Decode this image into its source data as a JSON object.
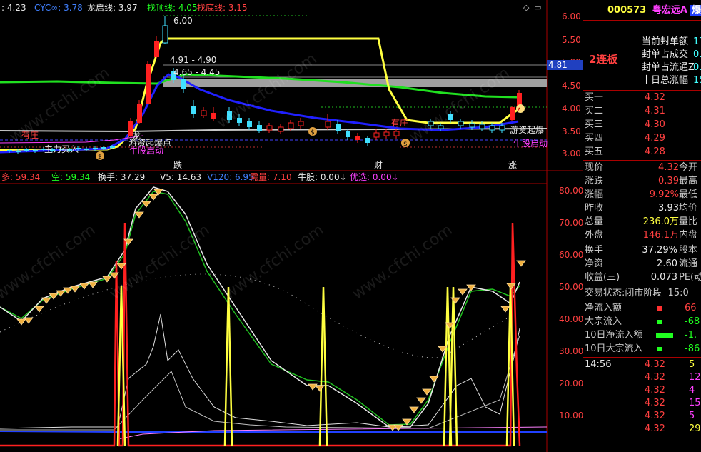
{
  "top_indicators": [
    {
      "text": ": 4.23",
      "color": "#e8e8e8"
    },
    {
      "text": "CYC∞: 3.78",
      "color": "#4080ff"
    },
    {
      "text": "龙启线: 3.97",
      "color": "#e8e8e8"
    },
    {
      "text": "找顶线: 4.05",
      "color": "#20ff20"
    },
    {
      "text": "找底线: 3.15",
      "color": "#ff4040"
    }
  ],
  "price_axis": [
    "6.00",
    "5.50",
    "5.00",
    "4.50",
    "4.00",
    "3.50",
    "3.00"
  ],
  "price_marker": "4.81",
  "chart_annotations": {
    "high": "6.00",
    "range1": "4.91 - 4.90",
    "range2": "4.65 - 4.45",
    "yz1": "有庄",
    "yz2": "有庄",
    "long1": "龙",
    "buy": "主力买入",
    "launch": "游资起爆点",
    "bull_start": "牛股启动",
    "bull_start2": "牛股启动",
    "explode": "游资起爆",
    "die": "跌",
    "cai": "财",
    "zhang": "涨"
  },
  "lower_indicators": [
    {
      "text": "多: 59.34",
      "color": "#ff4040"
    },
    {
      "text": "空: 59.34",
      "color": "#20ff20"
    },
    {
      "text": "换手: 37.29",
      "color": "#e8e8e8"
    },
    {
      "text": "V5: 14.63",
      "color": "#e8e8e8"
    },
    {
      "text": "V120: 6.95",
      "color": "#4080ff"
    },
    {
      "text": "需量: 7.10",
      "color": "#ff4040"
    },
    {
      "text": "牛股: 0.00↓",
      "color": "#e8e8e8"
    },
    {
      "text": "优选: 0.00↓",
      "color": "#ff40ff"
    }
  ],
  "lower_axis": [
    "80.00",
    "70.00",
    "60.00",
    "50.00",
    "40.00",
    "30.00",
    "20.00",
    "10.00"
  ],
  "stock": {
    "code": "000573",
    "name": "粤宏远A",
    "tag": "爆",
    "streak": "2连板",
    "seal_info": [
      {
        "label": "当前封单额",
        "value": "17"
      },
      {
        "label": "封单占成交",
        "value": "0."
      },
      {
        "label": "封单占流通Z",
        "value": "0."
      },
      {
        "label": "十日总涨幅",
        "value": "15."
      }
    ]
  },
  "order_book": [
    {
      "label": "买一",
      "price": "4.32"
    },
    {
      "label": "买二",
      "price": "4.31"
    },
    {
      "label": "买三",
      "price": "4.30"
    },
    {
      "label": "买四",
      "price": "4.29"
    },
    {
      "label": "买五",
      "price": "4.28"
    }
  ],
  "quote": [
    {
      "l1": "现价",
      "v1": "4.32",
      "c1": "red",
      "l2": "今开"
    },
    {
      "l1": "涨跌",
      "v1": "0.39",
      "c1": "red",
      "l2": "最高"
    },
    {
      "l1": "涨幅",
      "v1": "9.92%",
      "c1": "red",
      "l2": "最低"
    },
    {
      "l1": "昨收",
      "v1": "3.93",
      "c1": "wht",
      "l2": "均价"
    },
    {
      "l1": "总量",
      "v1": "236.0万",
      "c1": "yel",
      "l2": "量比"
    },
    {
      "l1": "外盘",
      "v1": "146.1万",
      "c1": "red",
      "l2": "内盘"
    }
  ],
  "quote2": [
    {
      "l1": "换手",
      "v1": "37.29%",
      "l2": "股本"
    },
    {
      "l1": "净资",
      "v1": "2.60",
      "l2": "流通"
    },
    {
      "l1": "收益(三)",
      "v1": "0.073",
      "l2": "PE(动)"
    }
  ],
  "trade_state": {
    "label": "交易状态:",
    "value": "闭市阶段",
    "time": "15:0"
  },
  "flows": [
    {
      "label": "净流入额",
      "bar": "red",
      "value": "66",
      "vcolor": "red"
    },
    {
      "label": "大宗流入",
      "bar": "green",
      "value": "-68",
      "vcolor": "grn"
    },
    {
      "label": "10日净流入额",
      "bar": "greenlong",
      "value": "-1.",
      "vcolor": "grn"
    },
    {
      "label": "10日大宗流入",
      "bar": "green",
      "value": "-86",
      "vcolor": "grn"
    }
  ],
  "ticks": [
    {
      "time": "14:56",
      "price": "4.32",
      "vol": "5",
      "vcolor": "#ffff40"
    },
    {
      "time": "",
      "price": "4.32",
      "vol": "12",
      "vcolor": "#ff40ff"
    },
    {
      "time": "",
      "price": "4.32",
      "vol": "4",
      "vcolor": "#ff40ff"
    },
    {
      "time": "",
      "price": "4.32",
      "vol": "15",
      "vcolor": "#ff40ff"
    },
    {
      "time": "",
      "price": "4.32",
      "vol": "5",
      "vcolor": "#ff40ff"
    },
    {
      "time": "",
      "price": "4.32",
      "vol": "29",
      "vcolor": "#ffff40"
    }
  ],
  "watermark": "www.cfchi.com"
}
